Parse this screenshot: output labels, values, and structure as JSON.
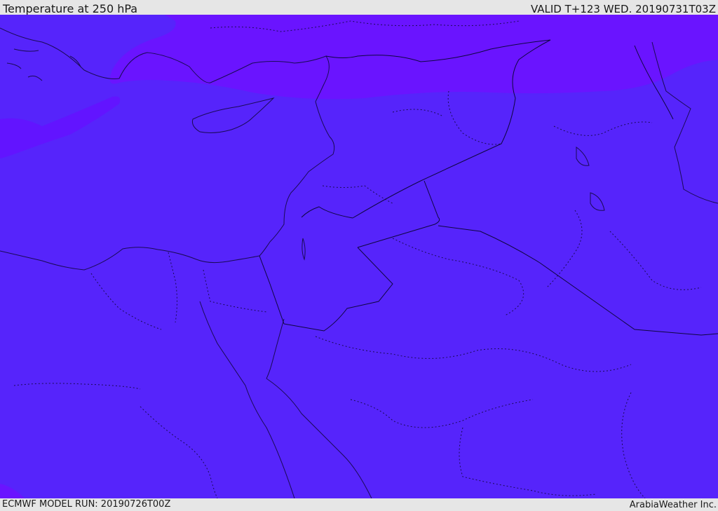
{
  "header": {
    "title": "Temperature at 250 hPa",
    "valid_time": "VALID T+123 WED. 20190731T03Z"
  },
  "footer": {
    "model_run": "ECMWF MODEL RUN: 20190726T00Z",
    "credit": "ArabiaWeather Inc."
  },
  "map": {
    "variable": "Temperature",
    "level": "250 hPa",
    "colors": {
      "main_fill": "#5624fb",
      "warm_band": "#6a14ff",
      "coastline": "#1a0a55",
      "border": "#0f0640"
    }
  }
}
